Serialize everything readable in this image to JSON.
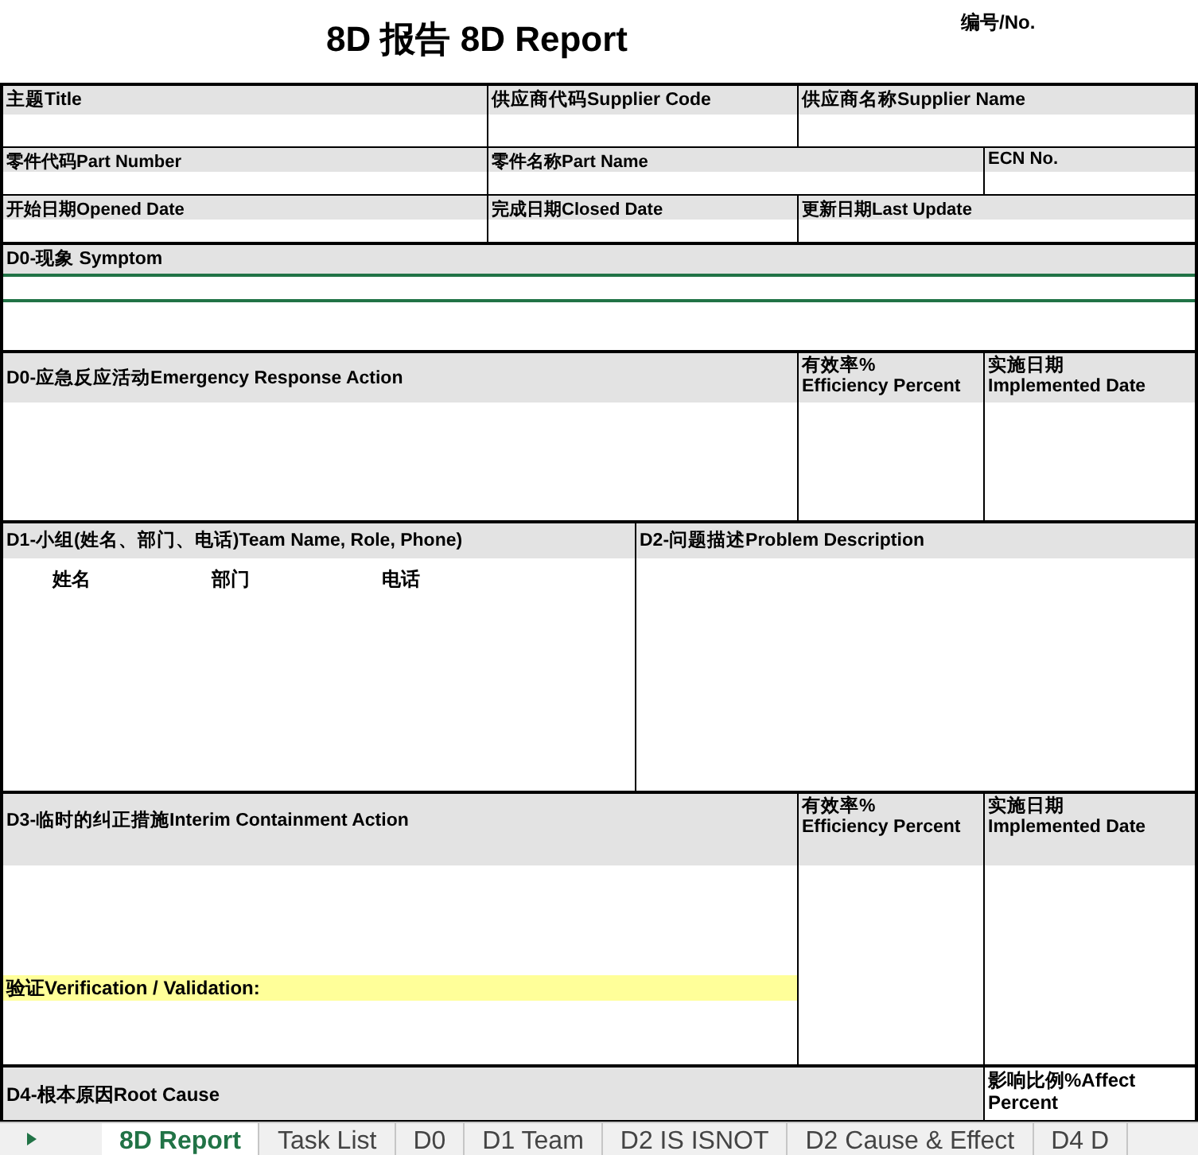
{
  "title": "8D 报告 8D Report",
  "doc_number_label": "编号/No.",
  "info_fields": [
    {
      "label": "主题Title"
    },
    {
      "label": "供应商代码Supplier Code"
    },
    {
      "label": "供应商名称Supplier Name"
    },
    {
      "label": "零件代码Part Number"
    },
    {
      "label": "零件名称Part Name"
    },
    {
      "label": "ECN No."
    },
    {
      "label": "开始日期Opened Date"
    },
    {
      "label": "完成日期Closed Date"
    },
    {
      "label": "更新日期Last Update"
    }
  ],
  "symptom": {
    "label": "D0-现象 Symptom"
  },
  "emergency_action": {
    "label": "D0-应急反应活动Emergency Response Action",
    "efficiency_label": "有效率%",
    "efficiency_label_en": "Efficiency Percent",
    "date_label": "实施日期",
    "date_label_en": "Implemented Date"
  },
  "team": {
    "label": "D1-小组(姓名、部门、电话)Team Name, Role, Phone)",
    "columns": [
      "姓名",
      "部门",
      "电话"
    ]
  },
  "problem": {
    "label": "D2-问题描述Problem Description"
  },
  "containment": {
    "label": "D3-临时的纠正措施Interim Containment Action",
    "efficiency_label": "有效率%",
    "efficiency_label_en": "Efficiency Percent",
    "date_label": "实施日期",
    "date_label_en": "Implemented Date",
    "verification_label": "验证Verification / Validation:"
  },
  "root_cause": {
    "label": "D4-根本原因Root Cause",
    "affect_label": "影响比例%Affect Percent"
  },
  "sheet_tabs": [
    {
      "label": "8D Report",
      "selected": true
    },
    {
      "label": "Task List",
      "selected": false
    },
    {
      "label": "D0",
      "selected": false
    },
    {
      "label": "D1 Team",
      "selected": false
    },
    {
      "label": "D2 IS ISNOT",
      "selected": false
    },
    {
      "label": "D2 Cause & Effect",
      "selected": false
    },
    {
      "label": "D4 D",
      "selected": false
    }
  ]
}
